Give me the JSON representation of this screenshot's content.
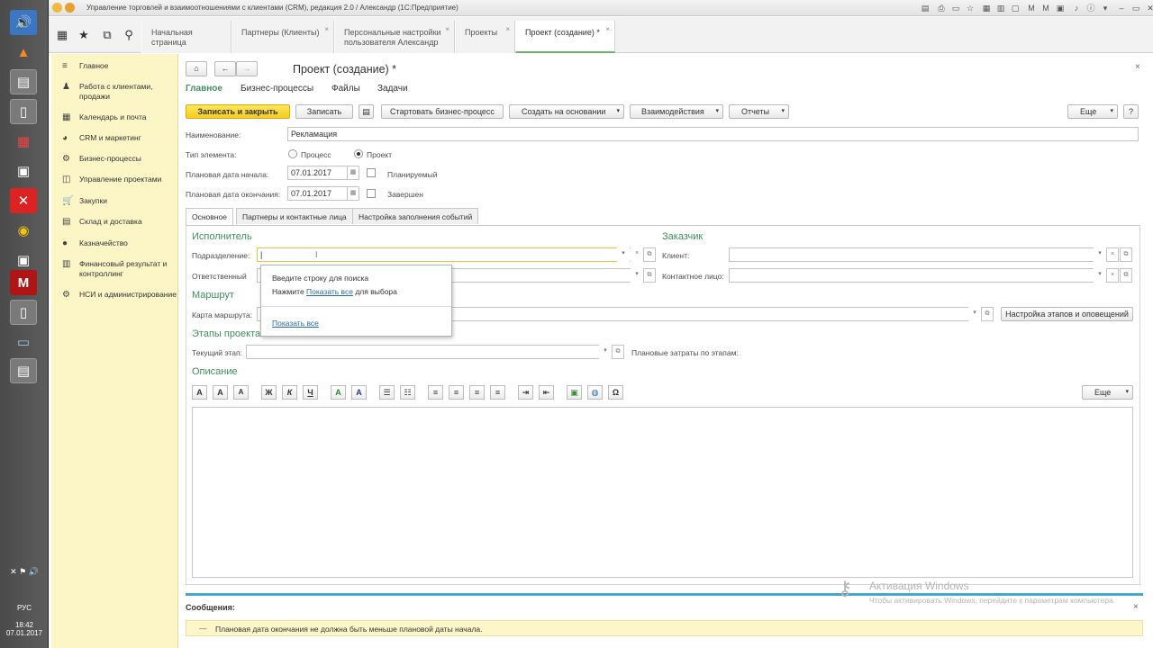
{
  "window": {
    "title": "Управление торговлей и взаимоотношениями с клиентами (CRM), редакция 2.0 / Александр  (1С:Предприятие)"
  },
  "taskbar": {
    "lang": "РУС",
    "time": "18:42",
    "date": "07.01.2017"
  },
  "tabs": [
    {
      "label": "Начальная страница"
    },
    {
      "label": "Партнеры (Клиенты)",
      "close": "×"
    },
    {
      "label": "Персональные настройки пользователя Александр",
      "close": "×"
    },
    {
      "label": "Проекты",
      "close": "×"
    },
    {
      "label": "Проект (создание) *",
      "close": "×"
    }
  ],
  "sidebar": {
    "items": [
      {
        "label": "Главное",
        "icon": "≡"
      },
      {
        "label": "Работа с клиентами, продажи",
        "icon": "♟"
      },
      {
        "label": "Календарь и почта",
        "icon": "▦"
      },
      {
        "label": "CRM и маркетинг",
        "icon": "◕"
      },
      {
        "label": "Бизнес-процессы",
        "icon": "⚙"
      },
      {
        "label": "Управление проектами",
        "icon": "◫"
      },
      {
        "label": "Закупки",
        "icon": "🛒"
      },
      {
        "label": "Склад и доставка",
        "icon": "▤"
      },
      {
        "label": "Казначейство",
        "icon": "●"
      },
      {
        "label": "Финансовый результат и контроллинг",
        "icon": "▥"
      },
      {
        "label": "НСИ и администрирование",
        "icon": "⚙"
      }
    ]
  },
  "form": {
    "title": "Проект (создание) *",
    "subtabs": [
      "Главное",
      "Бизнес-процессы",
      "Файлы",
      "Задачи"
    ],
    "toolbar": {
      "save_close": "Записать и закрыть",
      "save": "Записать",
      "start_bp": "Стартовать бизнес-процесс",
      "create_base": "Создать на основании",
      "interactions": "Взаимодействия",
      "reports": "Отчеты",
      "more": "Еще"
    },
    "name_label": "Наименование:",
    "name_value": "Рекламация",
    "type_label": "Тип элемента:",
    "type_options": [
      "Процесс",
      "Проект"
    ],
    "type_selected": "Проект",
    "start_label": "Плановая дата начала:",
    "start_value": "07.01.2017",
    "planned_label": "Планируемый",
    "end_label": "Плановая дата окончания:",
    "end_value": "07.01.2017",
    "done_label": "Завершен",
    "page_tabs": [
      "Основное",
      "Партнеры и контактные лица",
      "Настройка заполнения событий"
    ],
    "executor_title": "Исполнитель",
    "division_label": "Подразделение:",
    "responsible_label": "Ответственный",
    "customer_title": "Заказчик",
    "client_label": "Клиент:",
    "contact_label": "Контактное лицо:",
    "route_title": "Маршрут",
    "route_map_label": "Карта маршрута:",
    "stages_settings_button": "Настройка этапов и оповещений",
    "stages_title": "Этапы проекта",
    "current_stage_label": "Текущий этап:",
    "planned_costs_label": "Плановые затраты по этапам:",
    "description_title": "Описание",
    "desc_more": "Еще"
  },
  "popup": {
    "line1": "Введите строку для поиска",
    "line2_pre": "Нажмите",
    "line2_link": "Показать все",
    "line2_post": "для выбора",
    "show_all": "Показать все"
  },
  "messages": {
    "title": "Сообщения:",
    "text": "Плановая дата окончания не должна быть меньше плановой даты начала."
  },
  "watermark": {
    "title": "Активация Windows",
    "text": "Чтобы активировать Windows, перейдите к параметрам компьютера."
  }
}
